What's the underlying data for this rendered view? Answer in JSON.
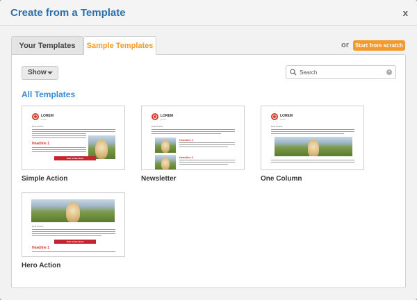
{
  "modal": {
    "title": "Create from a Template",
    "close_label": "x"
  },
  "tabs": [
    {
      "label": "Your Templates",
      "active": false
    },
    {
      "label": "Sample Templates",
      "active": true
    }
  ],
  "or_text": "or",
  "start_button": "Start from scratch",
  "toolbar": {
    "show_label": "Show",
    "search_placeholder": "Search"
  },
  "section_title": "All Templates",
  "thumbnail": {
    "brand": "LOREM",
    "brand_sub": "ipsum",
    "greeting": "Dear Friend,",
    "headline": "Headline 1",
    "headline_2": "Headline 2",
    "headline_3": "Headline 3",
    "cta": "Take Action Now!"
  },
  "templates": [
    {
      "name": "Simple Action"
    },
    {
      "name": "Newsletter"
    },
    {
      "name": "One Column"
    },
    {
      "name": "Hero Action"
    }
  ],
  "colors": {
    "title_blue": "#2c6fa8",
    "accent_orange": "#f29a2e",
    "section_blue": "#3a8ad0",
    "brand_red": "#d63a2c",
    "cta_red": "#c5252f"
  }
}
